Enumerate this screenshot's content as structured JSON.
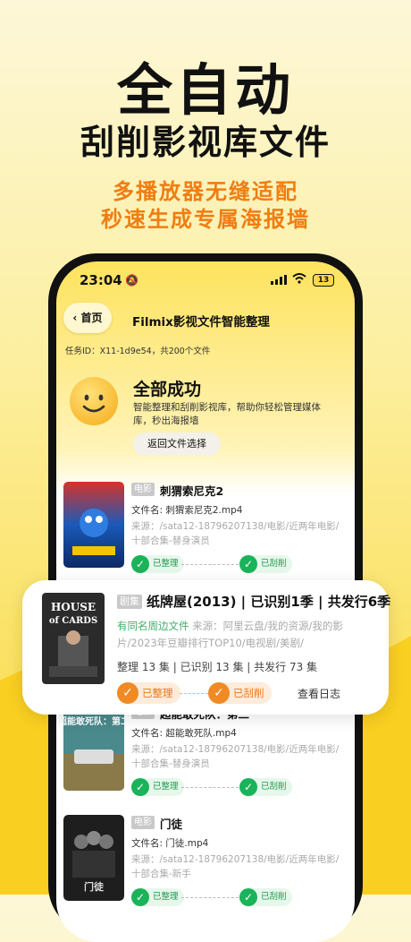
{
  "hero": {
    "title": "全自动",
    "subtitle": "刮削影视库文件",
    "tagline1": "多播放器无缝适配",
    "tagline2": "秒速生成专属海报墙"
  },
  "status": {
    "time": "23:04",
    "battery": "13"
  },
  "nav": {
    "back": "首页",
    "title": "Filmix影视文件智能整理"
  },
  "task": {
    "id_line": "任务ID：X11-1d9e54，共200个文件"
  },
  "result": {
    "title": "全部成功",
    "desc": "智能整理和刮削影视库，帮助你轻松管理媒体库，秒出海报墙",
    "return_btn": "返回文件选择"
  },
  "items": [
    {
      "category": "电影",
      "title": "刺猬索尼克2",
      "file": "文件名: 刺猬索尼克2.mp4",
      "source": "来源：/sata12-18796207138/电影/近两年电影/十部合集-替身演员",
      "status1": "已整理",
      "status2": "已刮削"
    },
    {
      "category": "电影",
      "title": "超能敢死队：第二",
      "file": "文件名: 超能敢死队.mp4",
      "source": "来源：/sata12-18796207138/电影/近两年电影/十部合集-替身演员",
      "status1": "已整理",
      "status2": "已刮削"
    },
    {
      "category": "电影",
      "title": "门徒",
      "file": "文件名: 门徒.mp4",
      "source": "来源：/sata12-18796207138/电影/近两年电影/十部合集-新手",
      "status1": "已整理",
      "status2": "已刮削"
    }
  ],
  "featured": {
    "category": "剧集",
    "title": "纸牌屋(2013) | 已识别1季 | 共发行6季",
    "same_name": "有同名周边文件",
    "source": " 来源：阿里云盘/我的资源/我的影片/2023年豆瓣排行TOP10/电视剧/美剧/",
    "stats": "整理 13 集 | 已识别 13 集 | 共发行 73 集",
    "status1": "已整理",
    "status2": "已刮削",
    "log": "查看日志",
    "poster_text1": "HOUSE",
    "poster_text2": "of CARDS"
  },
  "colors": {
    "accent_orange": "#f07d12",
    "green": "#1ab35a",
    "yellow": "#fbe36a"
  }
}
